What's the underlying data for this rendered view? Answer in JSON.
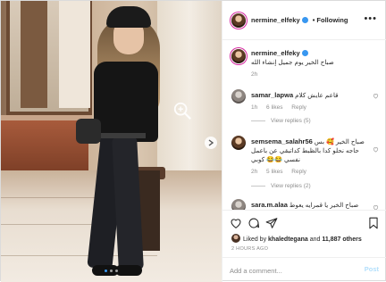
{
  "post": {
    "username": "nermine_elfeky",
    "follow_state": "• Following",
    "more_label": "•••"
  },
  "caption": {
    "username": "nermine_elfeky",
    "text": "صباح الخير يوم جميل إنشاء الله",
    "time": "2h"
  },
  "comments": [
    {
      "username": "samar_lapwa",
      "text": "قاعم عايش كلام",
      "time": "1h",
      "likes": "6 likes",
      "reply": "Reply",
      "view_replies": "View replies (5)"
    },
    {
      "username": "semsema_salahr56",
      "text": "صباح الخير 🥰 بس حاجه نحلو كدا بالظبط كداتبقي عن باعمل نفسي 😂😂 كوبي",
      "time": "2h",
      "likes": "5 likes",
      "reply": "Reply",
      "view_replies": "View replies (2)"
    },
    {
      "username": "sara.m.alaa",
      "text": "صباح الخير يا قمرايه يعوط"
    }
  ],
  "likes": {
    "prefix": "Liked by ",
    "user": "khaledtegana",
    "mid": " and ",
    "count": "11,887 others"
  },
  "time_ago": "2 HOURS AGO",
  "add_comment": {
    "placeholder": "Add a comment...",
    "post_label": "Post"
  },
  "carousel": {
    "slides": 3,
    "active": 1
  },
  "colors": {
    "accent": "#3897f0",
    "post_disabled": "#b2dffc",
    "muted": "#8e8e8e",
    "verified": "#3897f0"
  },
  "icons": [
    "zoom-icon",
    "chevron-right-icon",
    "more-icon",
    "heart-icon",
    "comment-icon",
    "share-icon",
    "bookmark-icon",
    "verified-badge-icon"
  ]
}
